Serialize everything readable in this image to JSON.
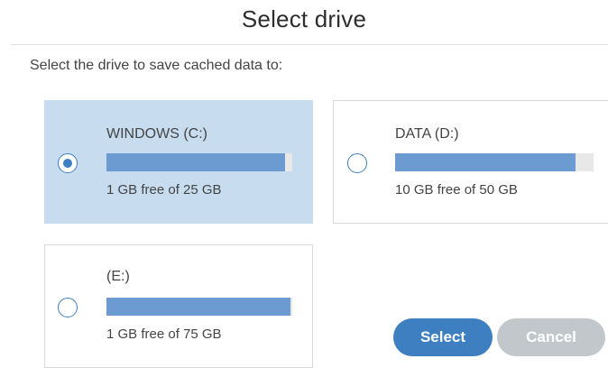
{
  "dialog": {
    "title": "Select drive",
    "subtitle": "Select the drive to save cached data to:"
  },
  "drives": [
    {
      "name": "WINDOWS (C:)",
      "free_text": "1 GB free of 25 GB",
      "used_fraction": 0.96,
      "selected": true
    },
    {
      "name": "DATA (D:)",
      "free_text": "10 GB free of 50 GB",
      "used_fraction": 0.91,
      "selected": false
    },
    {
      "name": "(E:)",
      "free_text": "1 GB free of 75 GB",
      "used_fraction": 0.99,
      "selected": false
    }
  ],
  "buttons": {
    "select_label": "Select",
    "cancel_label": "Cancel"
  },
  "colors": {
    "accent": "#3d7fc1",
    "selected_card": "#c7dcef",
    "bar_fill": "#6b9bd0",
    "bar_track": "#e8e8e8",
    "cancel_disabled": "#c2c7cc"
  },
  "icons": {
    "radio_selected": "radio-selected-icon",
    "radio_unselected": "radio-unselected-icon"
  }
}
